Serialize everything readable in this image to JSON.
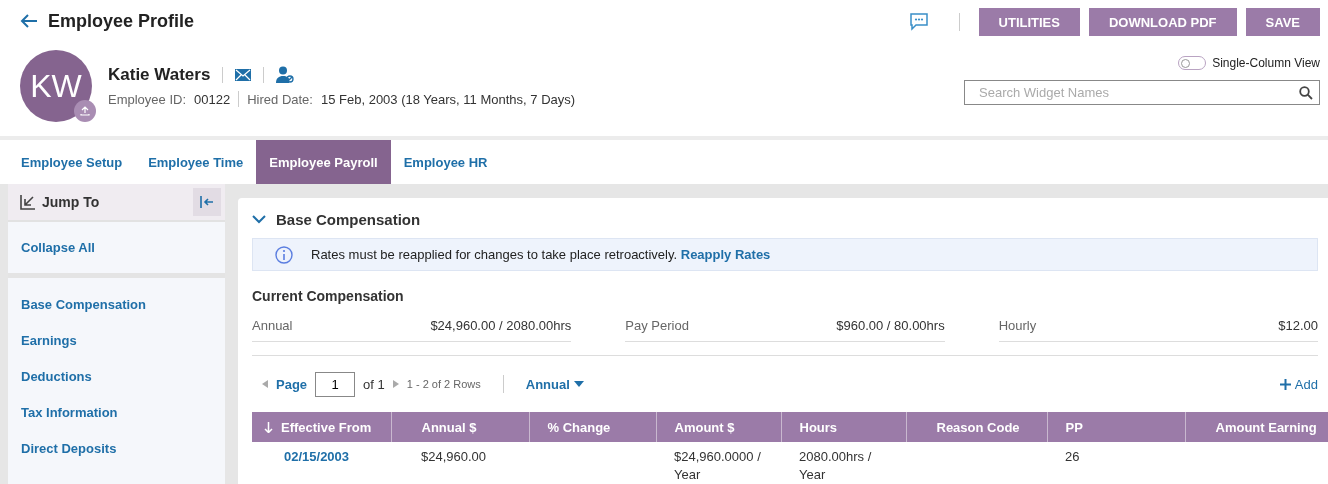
{
  "header": {
    "title": "Employee Profile",
    "buttons": [
      "UTILITIES",
      "DOWNLOAD PDF",
      "SAVE"
    ]
  },
  "employee": {
    "initials": "KW",
    "name": "Katie Waters",
    "id_label": "Employee ID:",
    "id": "00122",
    "hired_label": "Hired Date:",
    "hired": "15 Feb, 2003 (18 Years, 11 Months, 7 Days)"
  },
  "single_column_view": {
    "label": "Single-Column View",
    "on": false
  },
  "search": {
    "placeholder": "Search Widget Names"
  },
  "tabs": [
    {
      "label": "Employee Setup",
      "selected": false
    },
    {
      "label": "Employee Time",
      "selected": false
    },
    {
      "label": "Employee Payroll",
      "selected": true
    },
    {
      "label": "Employee HR",
      "selected": false
    }
  ],
  "sidebar": {
    "title": "Jump To",
    "collapse_all": "Collapse All",
    "items": [
      "Base Compensation",
      "Earnings",
      "Deductions",
      "Tax Information",
      "Direct Deposits"
    ]
  },
  "section": {
    "title": "Base Compensation",
    "expanded": true,
    "notice": {
      "text": "Rates must be reapplied for changes to take place retroactively.",
      "link": "Reapply Rates"
    },
    "current": {
      "title": "Current Compensation",
      "items": [
        {
          "label": "Annual",
          "value": "$24,960.00 / 2080.00hrs"
        },
        {
          "label": "Pay Period",
          "value": "$960.00 / 80.00hrs"
        },
        {
          "label": "Hourly",
          "value": "$12.00"
        }
      ]
    },
    "pager": {
      "page_label": "Page",
      "page": "1",
      "of": "of 1",
      "rows": "1 - 2 of 2 Rows",
      "period": "Annual",
      "add": "Add"
    },
    "table": {
      "columns": [
        {
          "label": "Effective From",
          "sorted": true
        },
        {
          "label": "Annual $",
          "sorted": false
        },
        {
          "label": "% Change",
          "sorted": false
        },
        {
          "label": "Amount $",
          "sorted": false
        },
        {
          "label": "Hours",
          "sorted": false
        },
        {
          "label": "Reason Code",
          "sorted": false
        },
        {
          "label": "PP",
          "sorted": false
        },
        {
          "label": "Amount Earning",
          "sorted": false
        }
      ],
      "rows": [
        [
          "02/15/2003",
          "$24,960.00",
          "",
          "$24,960.0000 / Year",
          "2080.00hrs / Year",
          "",
          "26",
          ""
        ]
      ]
    }
  }
}
